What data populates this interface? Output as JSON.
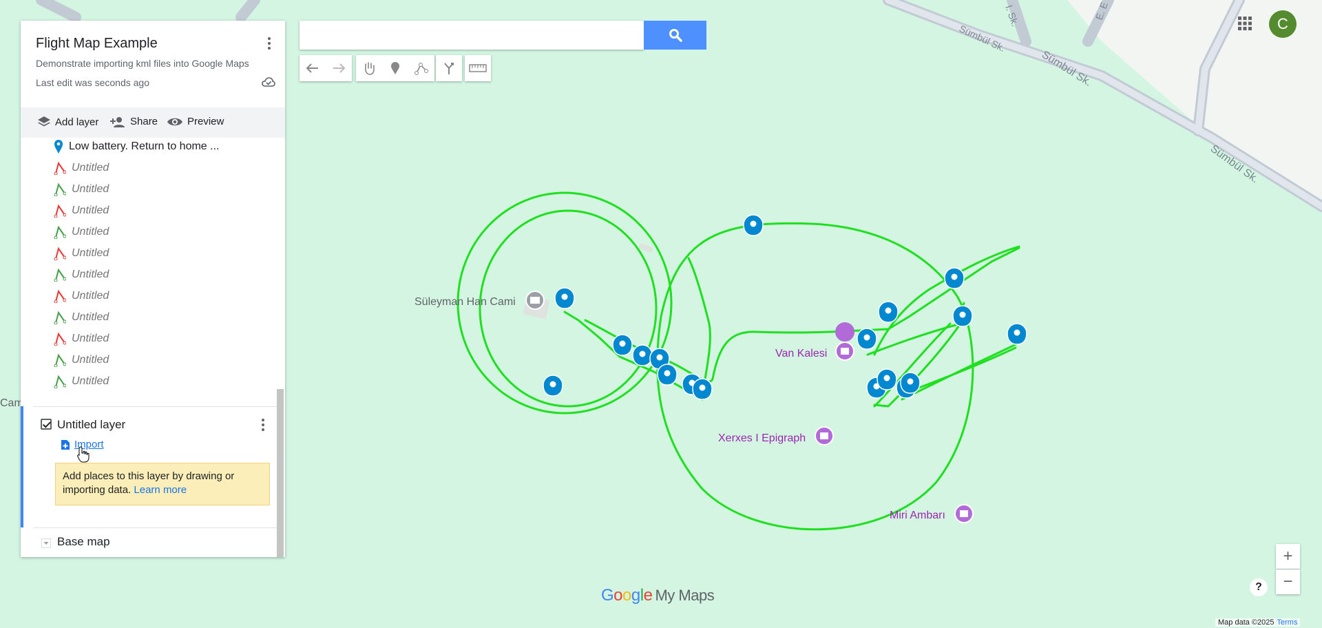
{
  "panel": {
    "title": "Flight Map Example",
    "description": "Demonstrate importing kml files into Google Maps",
    "last_edit": "Last edit was seconds ago",
    "toolbar": {
      "add_layer": "Add layer",
      "share": "Share",
      "preview": "Preview"
    },
    "items": [
      {
        "label": "Low battery. Return to home ...",
        "kind": "pin",
        "color": "#0288d1"
      },
      {
        "label": "Untitled",
        "kind": "line",
        "color": "#e53935"
      },
      {
        "label": "Untitled",
        "kind": "line",
        "color": "#43a047"
      },
      {
        "label": "Untitled",
        "kind": "line",
        "color": "#e53935"
      },
      {
        "label": "Untitled",
        "kind": "line",
        "color": "#43a047"
      },
      {
        "label": "Untitled",
        "kind": "line",
        "color": "#e53935"
      },
      {
        "label": "Untitled",
        "kind": "line",
        "color": "#43a047"
      },
      {
        "label": "Untitled",
        "kind": "line",
        "color": "#e53935"
      },
      {
        "label": "Untitled",
        "kind": "line",
        "color": "#43a047"
      },
      {
        "label": "Untitled",
        "kind": "line",
        "color": "#e53935"
      },
      {
        "label": "Untitled",
        "kind": "line",
        "color": "#43a047"
      },
      {
        "label": "Untitled",
        "kind": "line",
        "color": "#43a047"
      }
    ],
    "layer": {
      "name": "Untitled layer",
      "import_label": "Import",
      "note": "Add places to this layer by drawing or importing data.",
      "learn_more": "Learn more"
    },
    "base_map": "Base map"
  },
  "search": {
    "placeholder": "",
    "value": ""
  },
  "user": {
    "initial": "C",
    "avatar_color": "#558b2f"
  },
  "map": {
    "labels": {
      "mosque": "Süleyman Han Cami",
      "castle": "Van Kalesi",
      "epigraph": "Xerxes I Epigraph",
      "granary": "Miri Ambarı",
      "cam": "Cam",
      "street1": "Sümbül Sk.",
      "street2": "Sümbül Sk.",
      "street3": "Sümbül Sk.",
      "street4": "l. Sk.",
      "street5": "E. E"
    },
    "track_color": "#1ee01e",
    "pin_color": "#0288d1",
    "poi_color": "#b36ad9"
  },
  "zoom": {
    "in": "+",
    "out": "−"
  },
  "help": "?",
  "footer": {
    "map_data": "Map data ©2025",
    "terms": "Terms"
  },
  "logo": {
    "google": "Google",
    "my_maps": "My Maps"
  }
}
